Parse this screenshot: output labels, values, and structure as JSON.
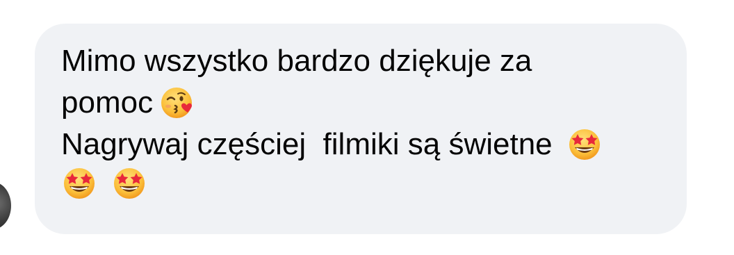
{
  "message": {
    "line1": "Mimo wszystko bardzo dziękuje za",
    "line2": "pomoc",
    "line3": "Nagrywaj częściej  filmiki są świetne",
    "emojis": {
      "line2": [
        "face-blowing-kiss-icon"
      ],
      "line3": [
        "star-struck-icon"
      ],
      "line4": [
        "star-struck-icon",
        "star-struck-icon"
      ]
    }
  },
  "colors": {
    "bubble_bg": "#f0f2f5",
    "text": "#050505"
  }
}
